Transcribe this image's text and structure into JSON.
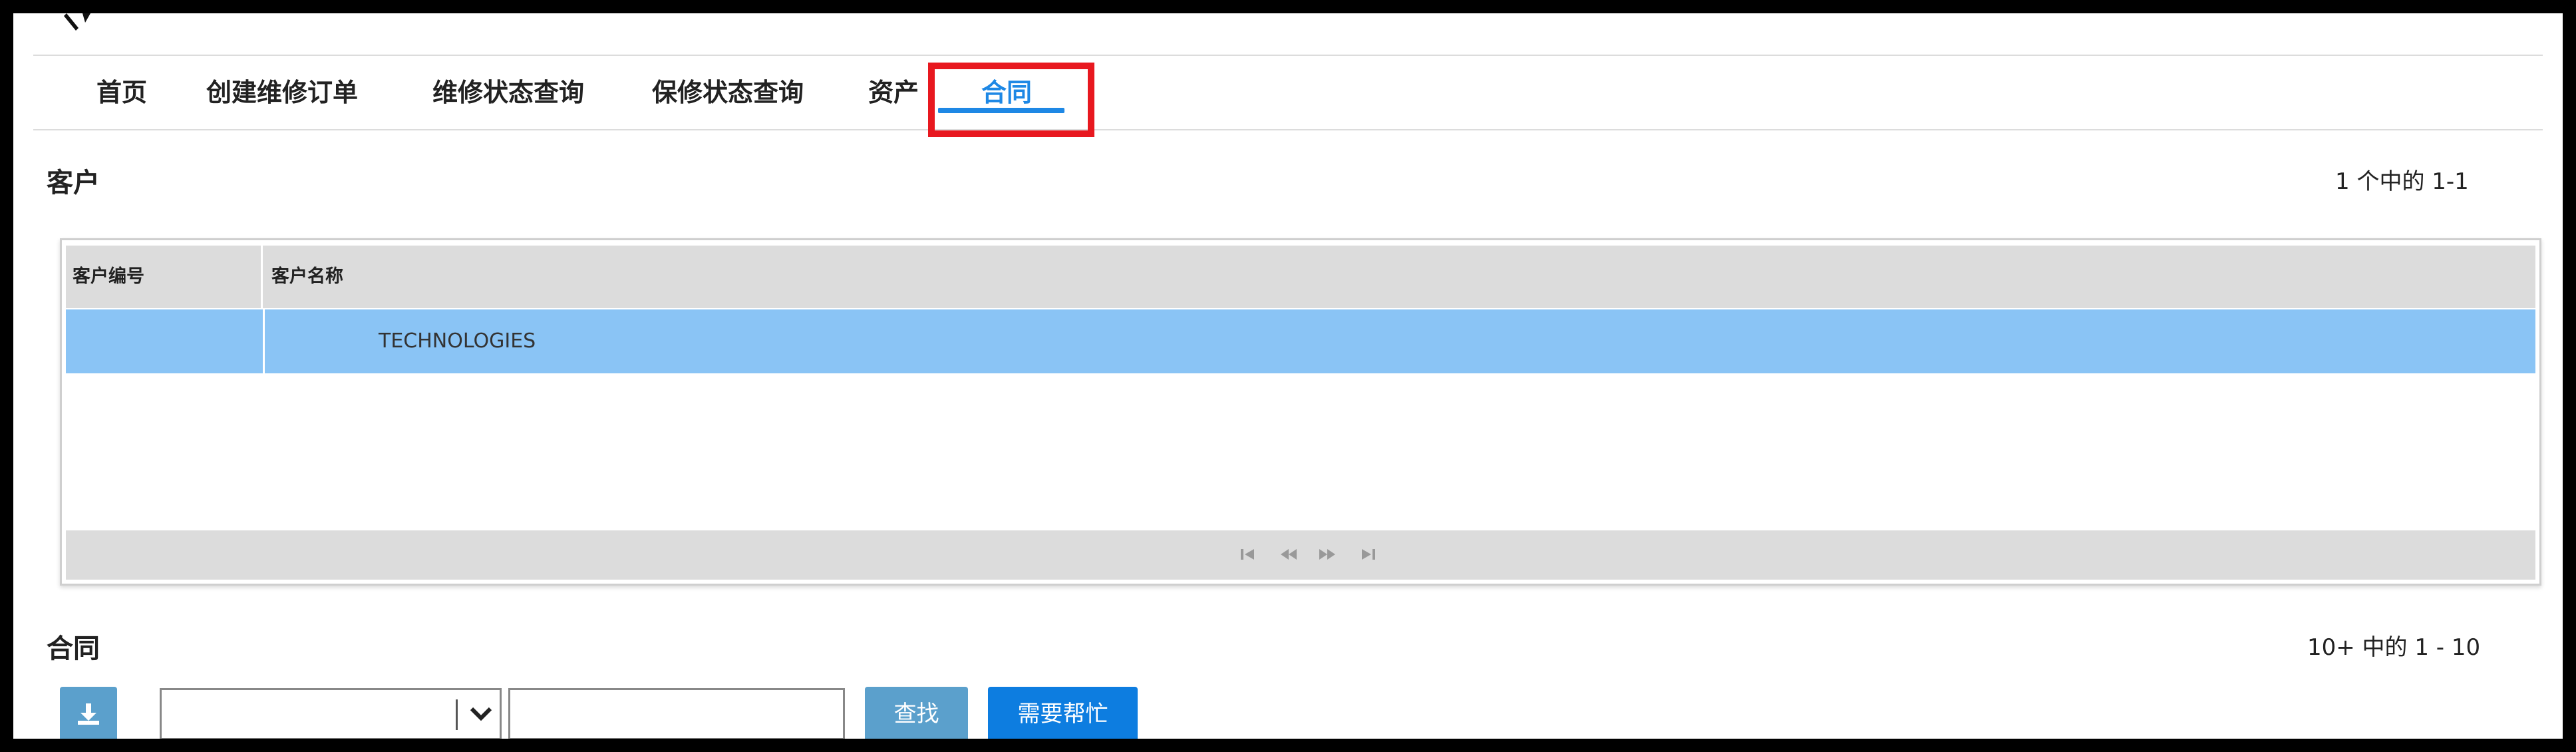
{
  "nav": {
    "items": [
      {
        "label": "首页"
      },
      {
        "label": "创建维修订单"
      },
      {
        "label": "维修状态查询"
      },
      {
        "label": "保修状态查询"
      },
      {
        "label": "资产"
      },
      {
        "label": "合同"
      }
    ],
    "active_index": 5
  },
  "customer_section": {
    "title": "客户",
    "count_text": "1 个中的 1-1",
    "columns": [
      "客户编号",
      "客户名称"
    ],
    "rows": [
      {
        "id": "",
        "name": "TECHNOLOGIES"
      }
    ]
  },
  "contract_section": {
    "title": "合同",
    "count_text": "10+ 中的 1 - 10",
    "select_value": "",
    "search_value": "",
    "find_label": "查找",
    "help_label": "需要帮忙"
  },
  "icons": {
    "download": "download-icon",
    "chevron": "chevron-down-icon",
    "pager": [
      "first-page-icon",
      "prev-page-icon",
      "next-page-icon",
      "last-page-icon"
    ]
  },
  "colors": {
    "accent": "#1e88e5",
    "highlight_box": "#e8181f",
    "selected_row": "#8ac4f5",
    "button": "#5ba0cc",
    "help_button": "#0d7de0"
  }
}
